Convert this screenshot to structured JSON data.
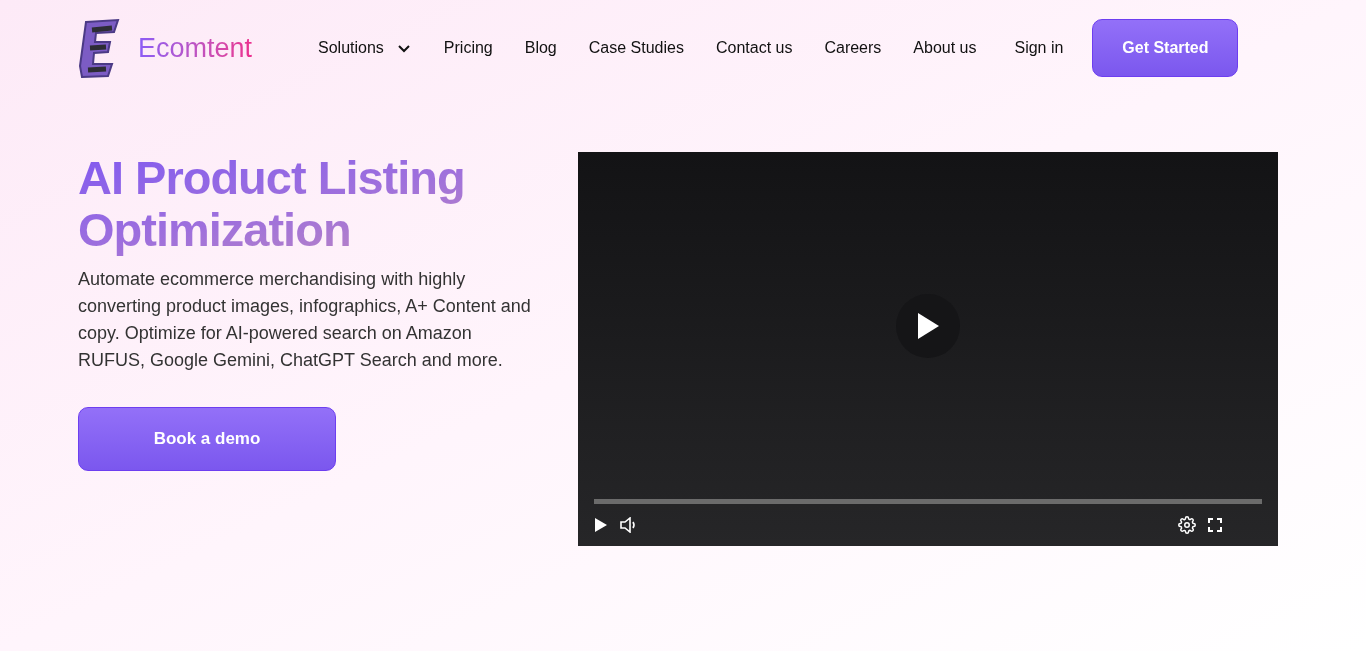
{
  "header": {
    "logo_text": "Ecomtent",
    "nav": [
      {
        "label": "Solutions",
        "has_menu": true
      },
      {
        "label": "Pricing",
        "has_menu": false
      },
      {
        "label": "Blog",
        "has_menu": false
      },
      {
        "label": "Case Studies",
        "has_menu": false
      },
      {
        "label": "Contact us",
        "has_menu": false
      },
      {
        "label": "Careers",
        "has_menu": false
      },
      {
        "label": "About us",
        "has_menu": false
      }
    ],
    "sign_in": "Sign in",
    "cta": "Get Started"
  },
  "hero": {
    "title": "AI Product Listing Optimization",
    "description": "Automate ecommerce merchandising with highly converting product images, infographics, A+ Content and copy. Optimize for AI-powered search on Amazon RUFUS, Google Gemini, ChatGPT Search and more.",
    "button": "Book a demo"
  }
}
